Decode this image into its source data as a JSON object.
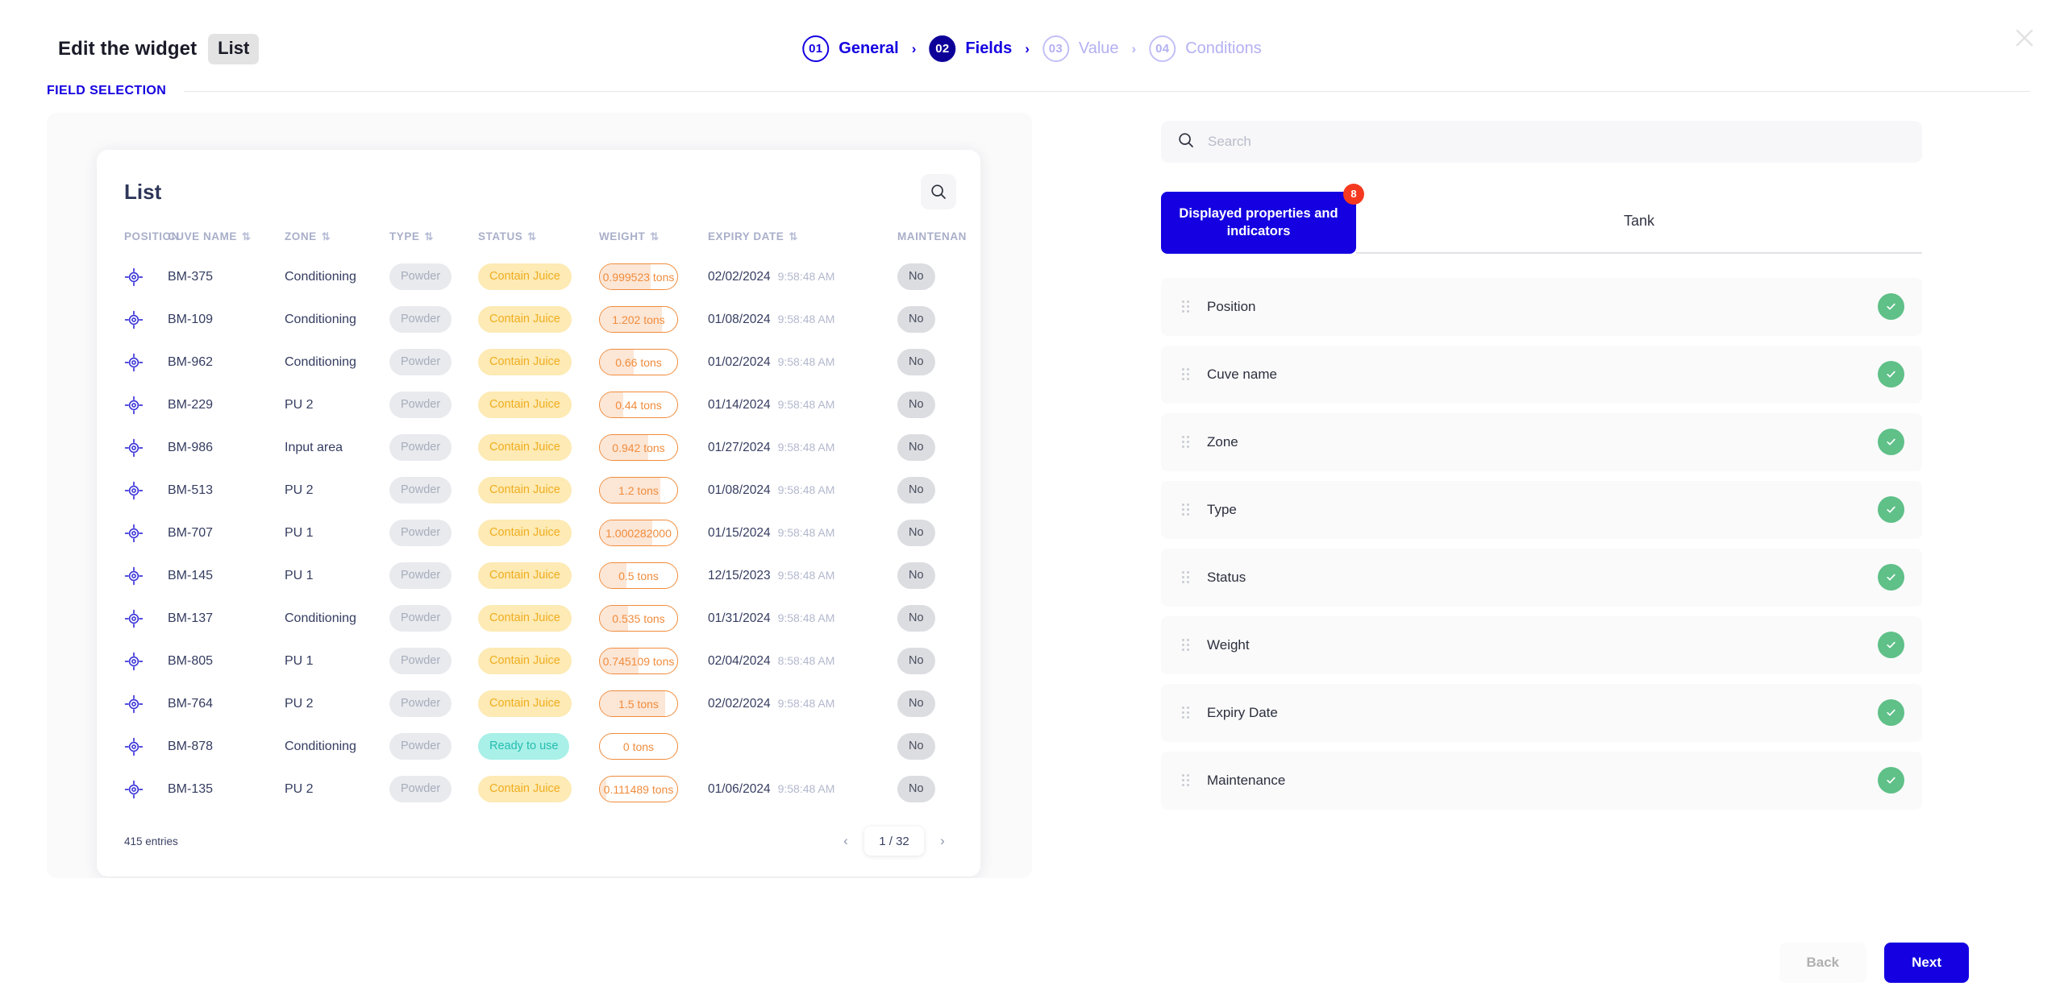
{
  "header": {
    "title": "Edit the widget",
    "widget_chip": "List",
    "close_icon": "close-icon"
  },
  "stepper": {
    "steps": [
      {
        "num": "01",
        "label": "General",
        "state": "done"
      },
      {
        "num": "02",
        "label": "Fields",
        "state": "active"
      },
      {
        "num": "03",
        "label": "Value",
        "state": "todo"
      },
      {
        "num": "04",
        "label": "Conditions",
        "state": "todo"
      }
    ],
    "separator": "›"
  },
  "section": {
    "label": "FIELD SELECTION"
  },
  "preview": {
    "card_title": "List",
    "search_icon": "search-icon",
    "columns": [
      {
        "label": "POSITION",
        "sortable": false
      },
      {
        "label": "CUVE NAME",
        "sortable": true
      },
      {
        "label": "ZONE",
        "sortable": true
      },
      {
        "label": "TYPE",
        "sortable": true
      },
      {
        "label": "STATUS",
        "sortable": true
      },
      {
        "label": "WEIGHT",
        "sortable": true
      },
      {
        "label": "EXPIRY DATE",
        "sortable": true
      },
      {
        "label": "MAINTENAN",
        "sortable": false
      }
    ],
    "rows": [
      {
        "position": "target-icon",
        "name": "BM-375",
        "zone": "Conditioning",
        "type": "Powder",
        "status": "Contain Juice",
        "status_kind": "juice",
        "weight": "0.999523 tons",
        "weight_pct": 66,
        "date": "02/02/2024",
        "time": "9:58:48 AM",
        "maintenance": "No"
      },
      {
        "position": "target-icon",
        "name": "BM-109",
        "zone": "Conditioning",
        "type": "Powder",
        "status": "Contain Juice",
        "status_kind": "juice",
        "weight": "1.202 tons",
        "weight_pct": 80,
        "date": "01/08/2024",
        "time": "9:58:48 AM",
        "maintenance": "No"
      },
      {
        "position": "target-icon",
        "name": "BM-962",
        "zone": "Conditioning",
        "type": "Powder",
        "status": "Contain Juice",
        "status_kind": "juice",
        "weight": "0.66 tons",
        "weight_pct": 44,
        "date": "01/02/2024",
        "time": "9:58:48 AM",
        "maintenance": "No"
      },
      {
        "position": "target-icon",
        "name": "BM-229",
        "zone": "PU 2",
        "type": "Powder",
        "status": "Contain Juice",
        "status_kind": "juice",
        "weight": "0.44 tons",
        "weight_pct": 30,
        "date": "01/14/2024",
        "time": "9:58:48 AM",
        "maintenance": "No"
      },
      {
        "position": "target-icon",
        "name": "BM-986",
        "zone": "Input area",
        "type": "Powder",
        "status": "Contain Juice",
        "status_kind": "juice",
        "weight": "0.942 tons",
        "weight_pct": 62,
        "date": "01/27/2024",
        "time": "9:58:48 AM",
        "maintenance": "No"
      },
      {
        "position": "target-icon",
        "name": "BM-513",
        "zone": "PU 2",
        "type": "Powder",
        "status": "Contain Juice",
        "status_kind": "juice",
        "weight": "1.2 tons",
        "weight_pct": 78,
        "date": "01/08/2024",
        "time": "9:58:48 AM",
        "maintenance": "No"
      },
      {
        "position": "target-icon",
        "name": "BM-707",
        "zone": "PU 1",
        "type": "Powder",
        "status": "Contain Juice",
        "status_kind": "juice",
        "weight": "1.000282000",
        "weight_pct": 68,
        "date": "01/15/2024",
        "time": "9:58:48 AM",
        "maintenance": "No"
      },
      {
        "position": "target-icon",
        "name": "BM-145",
        "zone": "PU 1",
        "type": "Powder",
        "status": "Contain Juice",
        "status_kind": "juice",
        "weight": "0.5 tons",
        "weight_pct": 34,
        "date": "12/15/2023",
        "time": "9:58:48 AM",
        "maintenance": "No"
      },
      {
        "position": "target-icon",
        "name": "BM-137",
        "zone": "Conditioning",
        "type": "Powder",
        "status": "Contain Juice",
        "status_kind": "juice",
        "weight": "0.535 tons",
        "weight_pct": 36,
        "date": "01/31/2024",
        "time": "9:58:48 AM",
        "maintenance": "No"
      },
      {
        "position": "target-icon",
        "name": "BM-805",
        "zone": "PU 1",
        "type": "Powder",
        "status": "Contain Juice",
        "status_kind": "juice",
        "weight": "0.745109 tons",
        "weight_pct": 50,
        "date": "02/04/2024",
        "time": "8:58:48 AM",
        "maintenance": "No"
      },
      {
        "position": "target-icon",
        "name": "BM-764",
        "zone": "PU 2",
        "type": "Powder",
        "status": "Contain Juice",
        "status_kind": "juice",
        "weight": "1.5 tons",
        "weight_pct": 84,
        "date": "02/02/2024",
        "time": "9:58:48 AM",
        "maintenance": "No"
      },
      {
        "position": "target-icon",
        "name": "BM-878",
        "zone": "Conditioning",
        "type": "Powder",
        "status": "Ready to use",
        "status_kind": "ready",
        "weight": "0 tons",
        "weight_pct": 0,
        "date": "",
        "time": "",
        "maintenance": "No"
      },
      {
        "position": "target-icon",
        "name": "BM-135",
        "zone": "PU 2",
        "type": "Powder",
        "status": "Contain Juice",
        "status_kind": "juice",
        "weight": "0.111489 tons",
        "weight_pct": 8,
        "date": "01/06/2024",
        "time": "9:58:48 AM",
        "maintenance": "No"
      }
    ],
    "footer": {
      "entries": "415 entries",
      "page": "1 / 32",
      "prev_icon": "chevron-left-icon",
      "next_icon": "chevron-right-icon"
    }
  },
  "config": {
    "search": {
      "placeholder": "Search",
      "value": "",
      "icon": "search-icon"
    },
    "tabs": [
      {
        "label": "Displayed properties and indicators",
        "badge": "8",
        "active": true
      },
      {
        "label": "Tank",
        "active": false
      }
    ],
    "properties": [
      {
        "label": "Position",
        "enabled": true,
        "drag_icon": "drag-handle-icon",
        "check_icon": "check-icon"
      },
      {
        "label": "Cuve name",
        "enabled": true,
        "drag_icon": "drag-handle-icon",
        "check_icon": "check-icon"
      },
      {
        "label": "Zone",
        "enabled": true,
        "drag_icon": "drag-handle-icon",
        "check_icon": "check-icon"
      },
      {
        "label": "Type",
        "enabled": true,
        "drag_icon": "drag-handle-icon",
        "check_icon": "check-icon"
      },
      {
        "label": "Status",
        "enabled": true,
        "drag_icon": "drag-handle-icon",
        "check_icon": "check-icon"
      },
      {
        "label": "Weight",
        "enabled": true,
        "drag_icon": "drag-handle-icon",
        "check_icon": "check-icon"
      },
      {
        "label": "Expiry Date",
        "enabled": true,
        "drag_icon": "drag-handle-icon",
        "check_icon": "check-icon"
      },
      {
        "label": "Maintenance",
        "enabled": true,
        "drag_icon": "drag-handle-icon",
        "check_icon": "check-icon"
      }
    ]
  },
  "footer": {
    "back_label": "Back",
    "next_label": "Next"
  },
  "colors": {
    "brand_blue": "#1400e0",
    "step_active": "#0d0099",
    "badge_red": "#f5391f",
    "check_green": "#5fc088",
    "status_juice_bg": "#fdeab4",
    "status_juice_fg": "#f0ad20",
    "status_ready_bg": "#a8f0e8",
    "status_ready_fg": "#25bdb0",
    "weight_border": "#f08c3c"
  }
}
